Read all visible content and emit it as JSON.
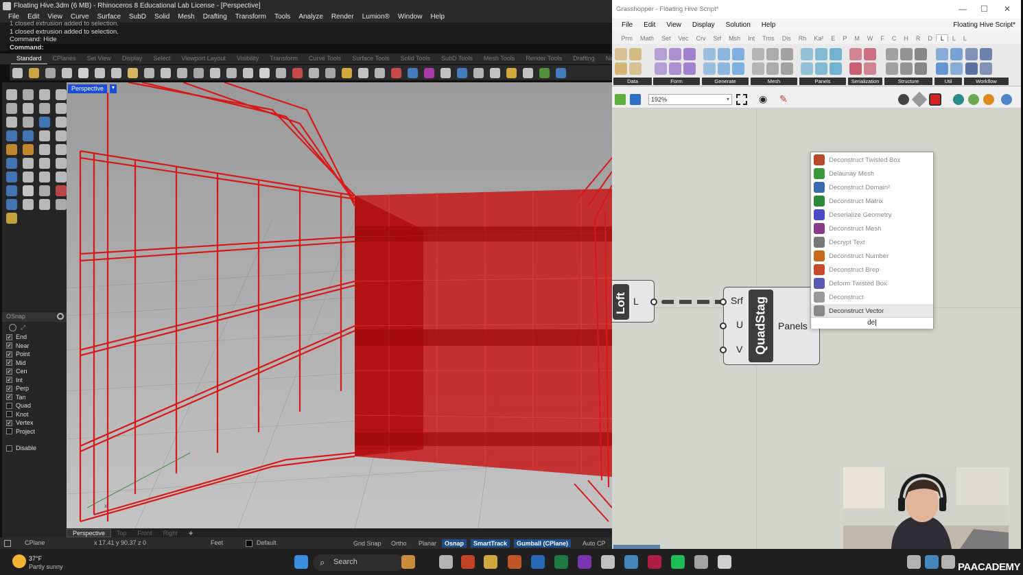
{
  "rhino": {
    "title": "Floating Hive.3dm (6 MB) - Rhinoceros 8 Educational Lab License - [Perspective]",
    "menu": [
      "File",
      "Edit",
      "View",
      "Curve",
      "Surface",
      "SubD",
      "Solid",
      "Mesh",
      "Drafting",
      "Transform",
      "Tools",
      "Analyze",
      "Render",
      "Lumion®",
      "Window",
      "Help"
    ],
    "command_history": [
      "1 closed extrusion added to selection.",
      "1 closed extrusion added to selection.",
      "Command: Hide"
    ],
    "command_prompt": "Command:",
    "toolbar_tabs": [
      "Standard",
      "CPlanes",
      "Set View",
      "Display",
      "Select",
      "Viewport Layout",
      "Visibility",
      "Transform",
      "Curve Tools",
      "Surface Tools",
      "Solid Tools",
      "SubD Tools",
      "Mesh Tools",
      "Render Tools",
      "Drafting",
      "Ne"
    ],
    "active_tab": "Standard",
    "viewport": {
      "label": "Perspective",
      "tabs": [
        "Perspective",
        "Top",
        "Front",
        "Right"
      ],
      "add_tab": "+",
      "axis_x": "x"
    },
    "osnap": {
      "title": "OSnap",
      "items": [
        {
          "label": "End",
          "checked": true
        },
        {
          "label": "Near",
          "checked": true
        },
        {
          "label": "Point",
          "checked": true
        },
        {
          "label": "Mid",
          "checked": true
        },
        {
          "label": "Cen",
          "checked": true
        },
        {
          "label": "Int",
          "checked": true
        },
        {
          "label": "Perp",
          "checked": true
        },
        {
          "label": "Tan",
          "checked": true
        },
        {
          "label": "Quad",
          "checked": false
        },
        {
          "label": "Knot",
          "checked": false
        },
        {
          "label": "Vertex",
          "checked": true
        },
        {
          "label": "Project",
          "checked": false
        }
      ],
      "disable_label": "Disable"
    },
    "status": {
      "cplane": "CPlane",
      "coords": "x 17.41  y 90.37  z 0",
      "units": "Feet",
      "layer": "Default",
      "grid_snap": "Grid Snap",
      "ortho": "Ortho",
      "planar": "Planar",
      "osnap": "Osnap",
      "smarttrack": "SmartTrack",
      "gumball": "Gumball (CPlane)",
      "auto": "Auto CP"
    }
  },
  "grasshopper": {
    "title": "Grasshopper - Floating Hive Script*",
    "document_name": "Floating Hive Script*",
    "menu": [
      "File",
      "Edit",
      "View",
      "Display",
      "Solution",
      "Help"
    ],
    "categories": [
      "Prm",
      "Math",
      "Set",
      "Vec",
      "Crv",
      "Srf",
      "Msh",
      "Int",
      "Trns",
      "Dis",
      "Rh",
      "Ka²",
      "E",
      "P",
      "M",
      "W",
      "F",
      "C",
      "H",
      "R",
      "D",
      "L",
      "L",
      "L"
    ],
    "active_category_index": 21,
    "ribbon_groups": [
      "Data",
      "Form",
      "Generate",
      "Mesh",
      "Panels",
      "Serialization",
      "Structure",
      "Util",
      "Workflow"
    ],
    "zoom": "192%",
    "components": {
      "loft_caption": "Loft",
      "loft_output": "L",
      "quad_caption": "QuadStag",
      "quad_inputs": [
        "Srf",
        "U",
        "V"
      ],
      "quad_output": "Panels"
    },
    "search_popup": {
      "query": "de",
      "results": [
        "Deconstruct Twisted Box",
        "Delaunay Mesh",
        "Deconstruct Domain²",
        "Deconstruct Matrix",
        "Deserialize Geometry",
        "Deconstruct Mesh",
        "Decrypt Text",
        "Deconstruct Number",
        "Deconstruct Brep",
        "Deform Twisted Box",
        "Deconstruct",
        "Deconstruct Vector"
      ],
      "selected_index": 11
    }
  },
  "taskbar": {
    "weather_temp": "37°F",
    "weather_desc": "Partly sunny",
    "search_label": "Search",
    "watermark": "PAACADEMY"
  },
  "colors": {
    "rhino_bg": "#2b2b2b",
    "viewport_label": "#1a4ed8",
    "model_red": "#d61818",
    "gh_canvas": "#d4d4ce",
    "active_status": "#1e4d8a"
  }
}
